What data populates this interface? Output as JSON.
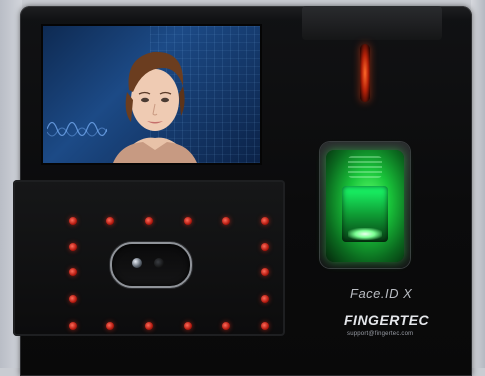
{
  "device": {
    "model": "Face.ID X",
    "brand": "FINGERTEC",
    "support": "support@fingertec.com"
  },
  "indicators": {
    "ir_led_color": "#ff5a1f",
    "red_dot_color": "#d42414",
    "red_dot_count": 18
  },
  "scanner": {
    "glow_color": "#2cff5a"
  },
  "screen": {
    "background_color": "#1c4a86"
  },
  "icons": {
    "camera": "camera-lens-icon",
    "fingerprint": "fingerprint-sensor-icon"
  }
}
